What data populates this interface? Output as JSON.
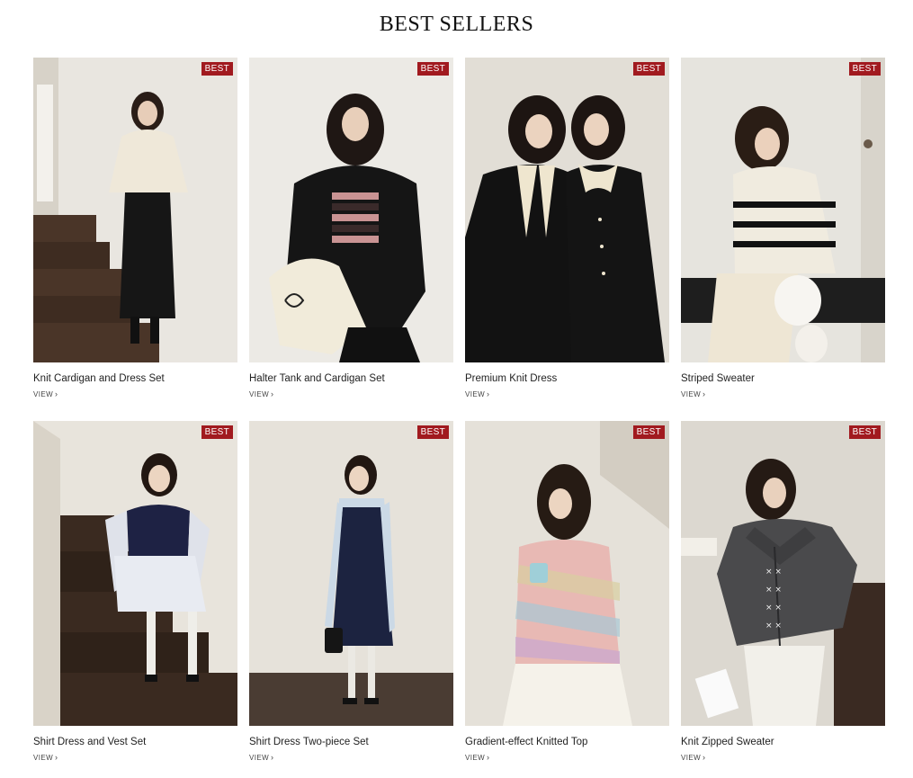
{
  "section": {
    "title": "BEST SELLERS"
  },
  "products": [
    {
      "name": "Knit Cardigan and Dress Set",
      "badge": "BEST",
      "view_label": "VIEW",
      "chevron": "›",
      "scene": "stairs-cream-cardigan"
    },
    {
      "name": "Halter Tank and Cardigan Set",
      "badge": "BEST",
      "view_label": "VIEW",
      "chevron": "›",
      "scene": "black-cardigan-stripes-bag"
    },
    {
      "name": "Premium Knit Dress",
      "badge": "BEST",
      "view_label": "VIEW",
      "chevron": "›",
      "scene": "two-models-black-dresses"
    },
    {
      "name": "Striped Sweater",
      "badge": "BEST",
      "view_label": "VIEW",
      "chevron": "›",
      "scene": "striped-sweater-dog"
    },
    {
      "name": "Shirt Dress and Vest Set",
      "badge": "BEST",
      "view_label": "VIEW",
      "chevron": "›",
      "scene": "stairs-navy-vest"
    },
    {
      "name": "Shirt Dress Two-piece Set",
      "badge": "BEST",
      "view_label": "VIEW",
      "chevron": "›",
      "scene": "navy-dress-striped-shirt"
    },
    {
      "name": "Gradient-effect Knitted Top",
      "badge": "BEST",
      "view_label": "VIEW",
      "chevron": "›",
      "scene": "rainbow-knit-mug"
    },
    {
      "name": "Knit Zipped Sweater",
      "badge": "BEST",
      "view_label": "VIEW",
      "chevron": "›",
      "scene": "grey-zipped-sweater"
    }
  ],
  "colors": {
    "badge_bg": "#a11a1f",
    "badge_text": "#ffffff"
  }
}
